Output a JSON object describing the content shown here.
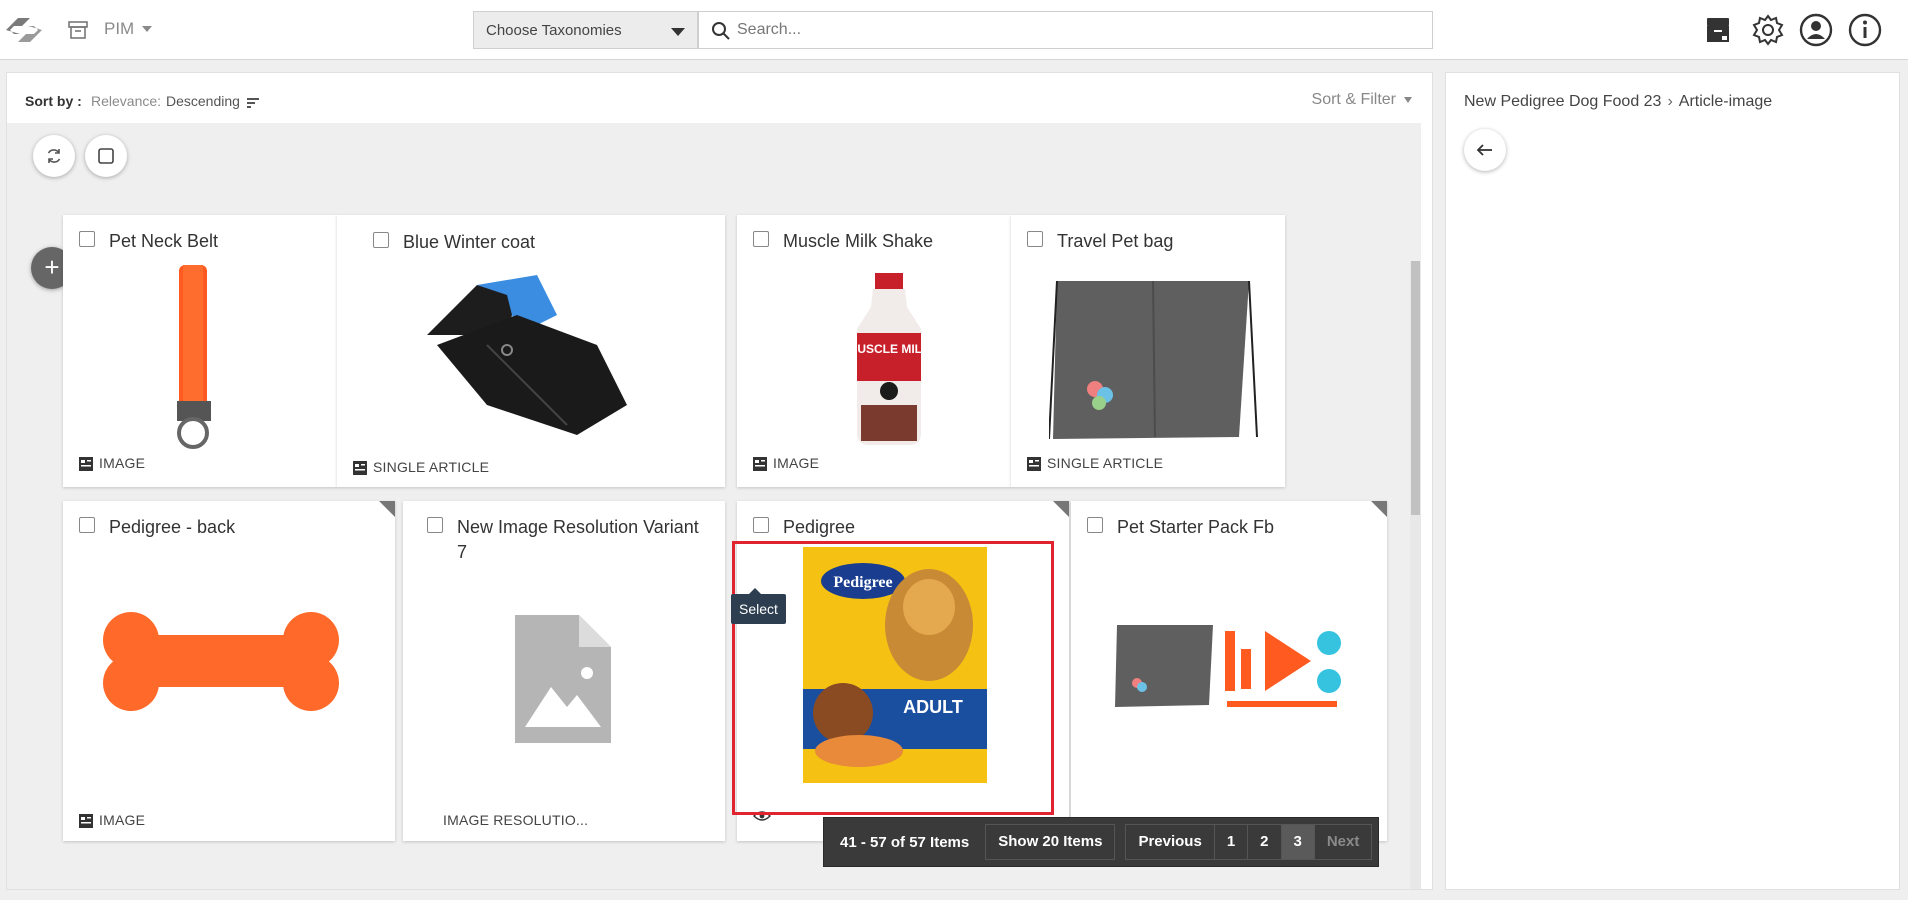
{
  "header": {
    "app_label": "PIM",
    "taxonomy_select": "Choose Taxonomies",
    "search_placeholder": "Search...",
    "icons": [
      "logo-icon",
      "archive-icon",
      "products-icon",
      "settings-icon",
      "user-icon",
      "info-icon"
    ]
  },
  "sortbar": {
    "sort_by_label": "Sort by :",
    "relevance_label": "Relevance:",
    "order_label": "Descending",
    "sort_filter_label": "Sort & Filter"
  },
  "cards": [
    {
      "title": "Pet Neck Belt",
      "type": "IMAGE",
      "image": "orange-collar"
    },
    {
      "title": "Blue Winter coat",
      "type": "SINGLE ARTICLE",
      "image": "dog-coat"
    },
    {
      "title": "Muscle Milk Shake",
      "type": "IMAGE",
      "image": "milk-bottle"
    },
    {
      "title": "Travel Pet bag",
      "type": "SINGLE ARTICLE",
      "image": "grey-bag"
    },
    {
      "title": "Pedigree - back",
      "type": "IMAGE",
      "image": "orange-bone"
    },
    {
      "title": "New Image Resolution Variant 7",
      "type": "IMAGE RESOLUTIO...",
      "image": "placeholder"
    },
    {
      "title": "Pedigree",
      "type": "",
      "image": "pedigree-bag",
      "selected": true
    },
    {
      "title": "Pet Starter Pack Fb",
      "type": "",
      "image": "starter-pack"
    }
  ],
  "image_text": {
    "muscle_milk": "MUSCLE MILK",
    "pedigree": "Pedigree",
    "adult": "ADULT"
  },
  "tooltip": "Select",
  "pagination": {
    "range_label": "41 - 57 of 57 Items",
    "show_label": "Show 20 Items",
    "previous": "Previous",
    "pages": [
      "1",
      "2",
      "3"
    ],
    "current_page": "3",
    "next": "Next"
  },
  "right_panel": {
    "breadcrumb": [
      "New Pedigree Dog Food 23",
      "Article-image"
    ]
  },
  "colors": {
    "selection_border": "#e0232f",
    "tooltip_bg": "#2c3e50",
    "pager_bg": "#3a3a3a"
  }
}
